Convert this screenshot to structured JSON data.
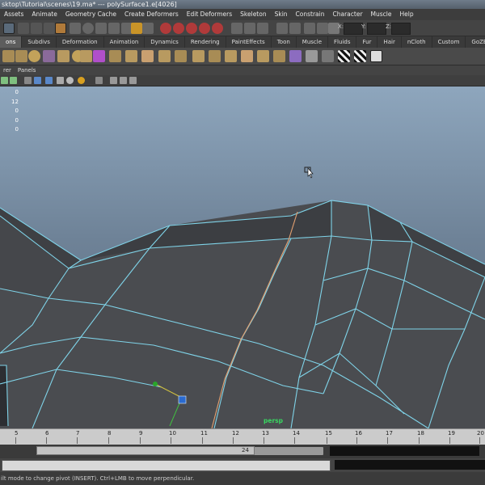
{
  "title_bar": {
    "text": "sktop\\Tutorial\\scenes\\19.ma*  ---  polySurface1.e[4026]"
  },
  "menu_bar": [
    "Assets",
    "Animate",
    "Geometry Cache",
    "Create Deformers",
    "Edit Deformers",
    "Skeleton",
    "Skin",
    "Constrain",
    "Character",
    "Muscle",
    "Help"
  ],
  "status_line": {
    "x_label": "X:",
    "y_label": "Y:",
    "z_label": "Z:"
  },
  "shelf_tabs": {
    "items": [
      "ons",
      "Subdivs",
      "Deformation",
      "Animation",
      "Dynamics",
      "Rendering",
      "PaintEffects",
      "Toon",
      "Muscle",
      "Fluids",
      "Fur",
      "Hair",
      "nCloth",
      "Custom",
      "GoZBrush"
    ],
    "active": "ons"
  },
  "shelf_icons": [
    "mesh-tool-icon",
    "mesh-tool-icon",
    "smooth-icon",
    "bridge-icon",
    "extrude-icon",
    "merge-icon",
    "append-icon",
    "purple-cube-icon",
    "fill-hole-icon",
    "wedge-icon",
    "split-icon",
    "bevel-icon",
    "poke-icon",
    "duplicate-icon",
    "extract-icon",
    "separate-icon",
    "combine-icon",
    "triangulate-icon",
    "quadrangulate-icon",
    "mirror-icon",
    "cleanup-icon",
    "uv-icon",
    "checker-icon",
    "checker-icon",
    "checker-icon",
    "goz-icon"
  ],
  "panel_menu": [
    "rer",
    "Panels"
  ],
  "hud": {
    "values": [
      "0",
      "12",
      "0",
      "0",
      "0"
    ]
  },
  "viewport": {
    "camera_label": "persp"
  },
  "time_slider": {
    "ticks": [
      "5",
      "6",
      "7",
      "8",
      "9",
      "10",
      "11",
      "12",
      "13",
      "14",
      "15",
      "16",
      "17",
      "18",
      "19",
      "20"
    ]
  },
  "range_slider": {
    "end_value": "24"
  },
  "help_line": {
    "text": "ilt mode to change pivot (INSERT).  Ctrl+LMB to move perpendicular."
  },
  "colors": {
    "wire": "#7fd3e8",
    "selected_edge": "#e3a070",
    "background_top": "#8ea6bd",
    "background_bottom": "#5a6876",
    "mesh_fill": "#4a4c50"
  }
}
